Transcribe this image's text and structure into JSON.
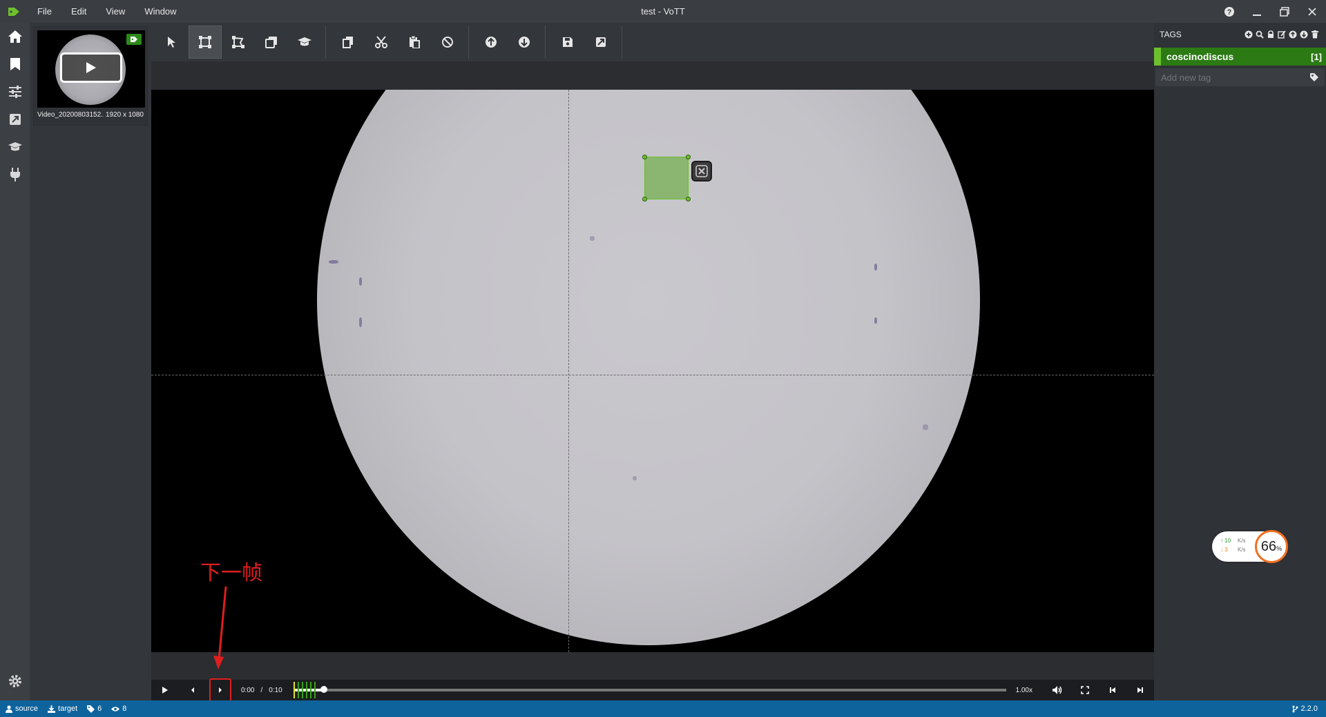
{
  "window": {
    "title": "test - VoTT"
  },
  "menu": [
    "File",
    "Edit",
    "View",
    "Window"
  ],
  "asset": {
    "name": "Video_20200803152...",
    "size": "1920 x 1080"
  },
  "player": {
    "current_time": "0:00",
    "separator": "/",
    "duration": "0:10",
    "rate": "1.00x",
    "progress": 0.043
  },
  "annotation": {
    "label": "下一帧"
  },
  "tags": {
    "title": "TAGS",
    "items": [
      {
        "name": "coscinodiscus",
        "count": "[1]",
        "color": "#6cc02c"
      }
    ],
    "add_placeholder": "Add new tag"
  },
  "netspeed": {
    "up": "10",
    "down": "3",
    "unit": "K/s",
    "percent": "66",
    "percent_unit": "%"
  },
  "statusbar": {
    "source": "source",
    "target": "target",
    "tags_count": "6",
    "visited_count": "8",
    "version": "2.2.0"
  },
  "colors": {
    "accent": "#6cc02c",
    "statusbar": "#0e639c",
    "annotation": "#e01e1e"
  }
}
